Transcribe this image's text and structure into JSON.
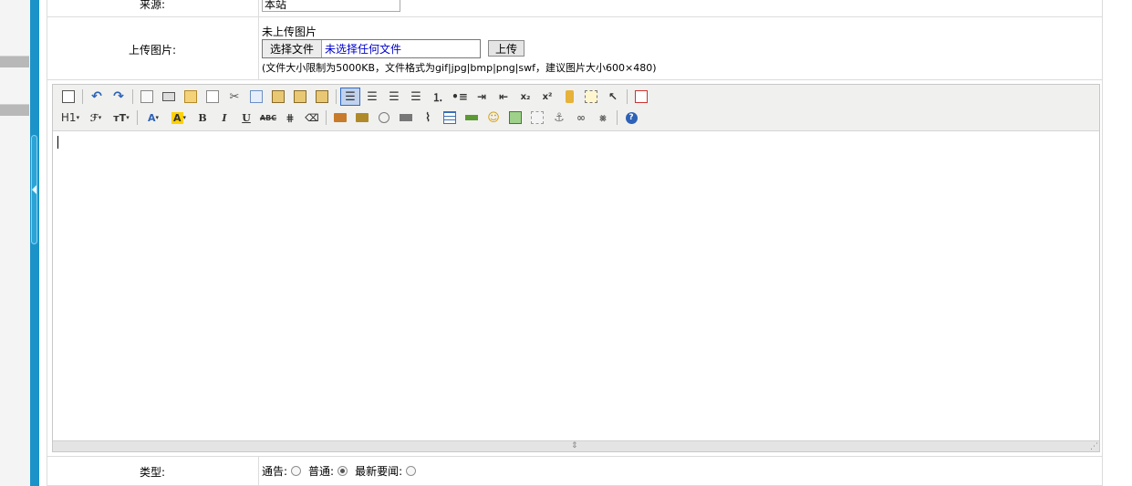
{
  "form": {
    "source_label": "来源:",
    "source_value": "本站",
    "upload_label": "上传图片:",
    "upload_status": "未上传图片",
    "file_button": "选择文件",
    "file_status": "未选择任何文件",
    "upload_button": "上传",
    "upload_hint": "(文件大小限制为5000KB，文件格式为gif|jpg|bmp|png|swf，建议图片大小600×480)",
    "type_label": "类型:",
    "type_options": [
      {
        "label": "通告:",
        "checked": false
      },
      {
        "label": "普通:",
        "checked": true
      },
      {
        "label": "最新要闻:",
        "checked": false
      }
    ]
  },
  "editor": {
    "toolbar_row2_text": {
      "heading": "H1",
      "font": "ℱ",
      "size": "тT",
      "font_color": "A",
      "highlight": "A",
      "bold": "B",
      "italic": "I",
      "underline": "U",
      "strike": "ABC"
    },
    "icons_row1": [
      "source-icon",
      "undo-icon",
      "redo-icon",
      "preview-icon",
      "print-icon",
      "template-icon",
      "code-icon",
      "cut-icon",
      "copy-icon",
      "paste-icon",
      "paste-text-icon",
      "paste-word-icon",
      "align-left-icon",
      "align-center-icon",
      "align-right-icon",
      "justify-icon",
      "ordered-list-icon",
      "unordered-list-icon",
      "indent-icon",
      "outdent-icon",
      "subscript-icon",
      "superscript-icon",
      "clear-format-icon",
      "select-all-icon",
      "cursor-icon",
      "fullscreen-icon"
    ],
    "accent": "#316ac5"
  },
  "colors": {
    "sidebar_blue": "#1b93c8",
    "border": "#dcdcdc",
    "toolbar_bg": "#f0f0ee"
  }
}
